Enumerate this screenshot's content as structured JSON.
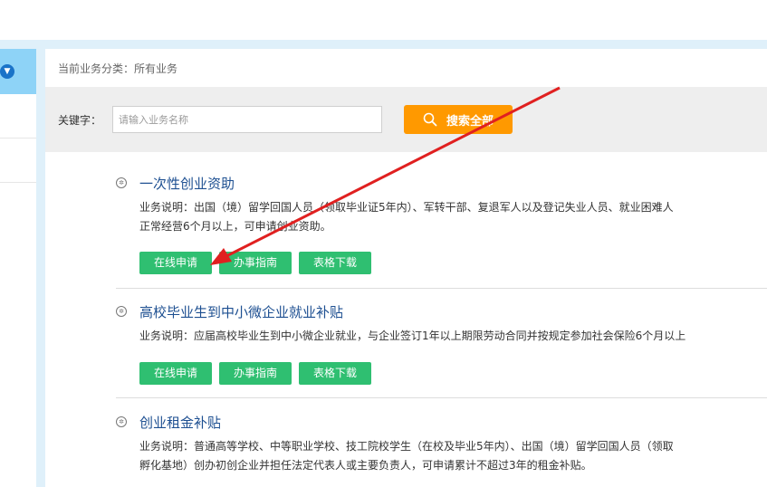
{
  "breadcrumb": "当前业务分类：所有业务",
  "search": {
    "label": "关键字：",
    "placeholder": "请输入业务名称",
    "button_label": "搜索全部"
  },
  "services": [
    {
      "title": "一次性创业资助",
      "desc_line1": "业务说明：出国（境）留学回国人员（领取毕业证5年内）、军转干部、复退军人以及登记失业人员、就业困难人",
      "desc_line2": "正常经营6个月以上，可申请创业资助。",
      "apply_label": "在线申请",
      "guide_label": "办事指南",
      "download_label": "表格下载"
    },
    {
      "title": "高校毕业生到中小微企业就业补贴",
      "desc_line1": "业务说明：应届高校毕业生到中小微企业就业，与企业签订1年以上期限劳动合同并按规定参加社会保险6个月以上",
      "apply_label": "在线申请",
      "guide_label": "办事指南",
      "download_label": "表格下载"
    },
    {
      "title": "创业租金补贴",
      "desc_line1": "业务说明：普通高等学校、中等职业学校、技工院校学生（在校及毕业5年内）、出国（境）留学回国人员（领取",
      "desc_line2": "孵化基地）创办初创企业并担任法定代表人或主要负责人，可申请累计不超过3年的租金补贴。"
    }
  ],
  "colors": {
    "search_button": "#ff9900",
    "action_button": "#2fbf71",
    "title_link": "#1d4f91",
    "annotation_arrow": "#e02020"
  }
}
